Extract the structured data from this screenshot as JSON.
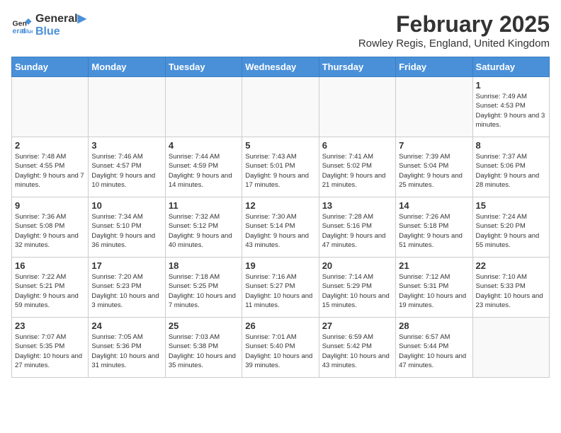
{
  "logo": {
    "line1": "General",
    "line2": "Blue"
  },
  "title": "February 2025",
  "location": "Rowley Regis, England, United Kingdom",
  "days_of_week": [
    "Sunday",
    "Monday",
    "Tuesday",
    "Wednesday",
    "Thursday",
    "Friday",
    "Saturday"
  ],
  "weeks": [
    [
      {
        "day": "",
        "info": ""
      },
      {
        "day": "",
        "info": ""
      },
      {
        "day": "",
        "info": ""
      },
      {
        "day": "",
        "info": ""
      },
      {
        "day": "",
        "info": ""
      },
      {
        "day": "",
        "info": ""
      },
      {
        "day": "1",
        "info": "Sunrise: 7:49 AM\nSunset: 4:53 PM\nDaylight: 9 hours and 3 minutes."
      }
    ],
    [
      {
        "day": "2",
        "info": "Sunrise: 7:48 AM\nSunset: 4:55 PM\nDaylight: 9 hours and 7 minutes."
      },
      {
        "day": "3",
        "info": "Sunrise: 7:46 AM\nSunset: 4:57 PM\nDaylight: 9 hours and 10 minutes."
      },
      {
        "day": "4",
        "info": "Sunrise: 7:44 AM\nSunset: 4:59 PM\nDaylight: 9 hours and 14 minutes."
      },
      {
        "day": "5",
        "info": "Sunrise: 7:43 AM\nSunset: 5:01 PM\nDaylight: 9 hours and 17 minutes."
      },
      {
        "day": "6",
        "info": "Sunrise: 7:41 AM\nSunset: 5:02 PM\nDaylight: 9 hours and 21 minutes."
      },
      {
        "day": "7",
        "info": "Sunrise: 7:39 AM\nSunset: 5:04 PM\nDaylight: 9 hours and 25 minutes."
      },
      {
        "day": "8",
        "info": "Sunrise: 7:37 AM\nSunset: 5:06 PM\nDaylight: 9 hours and 28 minutes."
      }
    ],
    [
      {
        "day": "9",
        "info": "Sunrise: 7:36 AM\nSunset: 5:08 PM\nDaylight: 9 hours and 32 minutes."
      },
      {
        "day": "10",
        "info": "Sunrise: 7:34 AM\nSunset: 5:10 PM\nDaylight: 9 hours and 36 minutes."
      },
      {
        "day": "11",
        "info": "Sunrise: 7:32 AM\nSunset: 5:12 PM\nDaylight: 9 hours and 40 minutes."
      },
      {
        "day": "12",
        "info": "Sunrise: 7:30 AM\nSunset: 5:14 PM\nDaylight: 9 hours and 43 minutes."
      },
      {
        "day": "13",
        "info": "Sunrise: 7:28 AM\nSunset: 5:16 PM\nDaylight: 9 hours and 47 minutes."
      },
      {
        "day": "14",
        "info": "Sunrise: 7:26 AM\nSunset: 5:18 PM\nDaylight: 9 hours and 51 minutes."
      },
      {
        "day": "15",
        "info": "Sunrise: 7:24 AM\nSunset: 5:20 PM\nDaylight: 9 hours and 55 minutes."
      }
    ],
    [
      {
        "day": "16",
        "info": "Sunrise: 7:22 AM\nSunset: 5:21 PM\nDaylight: 9 hours and 59 minutes."
      },
      {
        "day": "17",
        "info": "Sunrise: 7:20 AM\nSunset: 5:23 PM\nDaylight: 10 hours and 3 minutes."
      },
      {
        "day": "18",
        "info": "Sunrise: 7:18 AM\nSunset: 5:25 PM\nDaylight: 10 hours and 7 minutes."
      },
      {
        "day": "19",
        "info": "Sunrise: 7:16 AM\nSunset: 5:27 PM\nDaylight: 10 hours and 11 minutes."
      },
      {
        "day": "20",
        "info": "Sunrise: 7:14 AM\nSunset: 5:29 PM\nDaylight: 10 hours and 15 minutes."
      },
      {
        "day": "21",
        "info": "Sunrise: 7:12 AM\nSunset: 5:31 PM\nDaylight: 10 hours and 19 minutes."
      },
      {
        "day": "22",
        "info": "Sunrise: 7:10 AM\nSunset: 5:33 PM\nDaylight: 10 hours and 23 minutes."
      }
    ],
    [
      {
        "day": "23",
        "info": "Sunrise: 7:07 AM\nSunset: 5:35 PM\nDaylight: 10 hours and 27 minutes."
      },
      {
        "day": "24",
        "info": "Sunrise: 7:05 AM\nSunset: 5:36 PM\nDaylight: 10 hours and 31 minutes."
      },
      {
        "day": "25",
        "info": "Sunrise: 7:03 AM\nSunset: 5:38 PM\nDaylight: 10 hours and 35 minutes."
      },
      {
        "day": "26",
        "info": "Sunrise: 7:01 AM\nSunset: 5:40 PM\nDaylight: 10 hours and 39 minutes."
      },
      {
        "day": "27",
        "info": "Sunrise: 6:59 AM\nSunset: 5:42 PM\nDaylight: 10 hours and 43 minutes."
      },
      {
        "day": "28",
        "info": "Sunrise: 6:57 AM\nSunset: 5:44 PM\nDaylight: 10 hours and 47 minutes."
      },
      {
        "day": "",
        "info": ""
      }
    ]
  ]
}
